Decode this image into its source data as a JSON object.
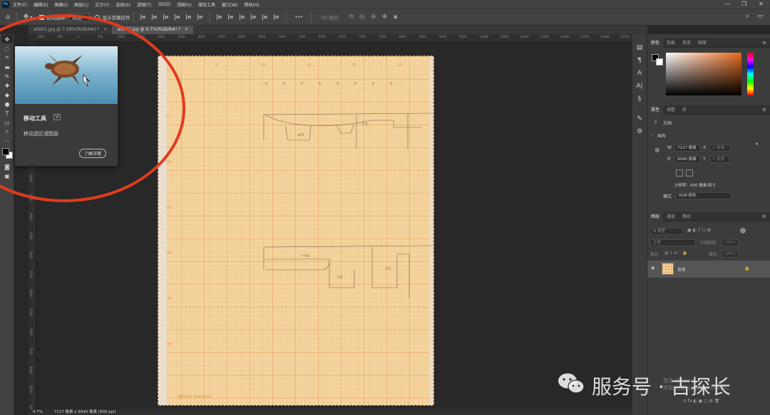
{
  "menubar": {
    "items": [
      "文件(F)",
      "编辑(E)",
      "图像(I)",
      "图层(L)",
      "文字(Y)",
      "选择(S)",
      "滤镜(T)",
      "3D(D)",
      "视图(V)",
      "增效工具",
      "窗口(W)",
      "帮助(H)"
    ],
    "app_icon": "Ps"
  },
  "optbar": {
    "auto_select_label": "自动选择:",
    "auto_select_value": "图层",
    "show_transform_label": "显示变换控件",
    "mode_3d_label": "3D 模式:",
    "more": "•••"
  },
  "tabs": [
    {
      "label": "a0001.jpg @ 7.58%(RGB/8#) *",
      "active": false
    },
    {
      "label": "a0002.jpg @ 9.7%(RGB/8#) *",
      "active": true
    }
  ],
  "ruler": {
    "h_ticks": [
      "1000",
      "500",
      "0",
      "500",
      "1000",
      "1500",
      "2000",
      "2500",
      "3000",
      "3500",
      "4000",
      "4500",
      "5000",
      "5500",
      "6000",
      "6500",
      "7000",
      "7500",
      "8000",
      "8500",
      "9000",
      "9500",
      "10000",
      "10500",
      "11000",
      "11500",
      "12000",
      "12500",
      "13000",
      "13500"
    ],
    "v_ticks": [
      "0",
      "500",
      "1000",
      "1500",
      "2000",
      "2500",
      "3000",
      "3500",
      "4000",
      "4500",
      "5000",
      "5500",
      "6000",
      "6500",
      "7000",
      "7500",
      "8000",
      "8500",
      "9000"
    ]
  },
  "tooltip": {
    "title": "移动工具",
    "shortcut": "V",
    "description": "移动选区或图层",
    "learn_more": "了解详情"
  },
  "paper": {
    "footer": "番号Y04    555X5公分",
    "top_numbers": [
      "5",
      "16",
      "10",
      "20",
      "15"
    ],
    "side_numbers": [
      "0",
      "5",
      "10",
      "15",
      "20",
      "25",
      "30"
    ],
    "sketch_labels_top": [
      "2",
      "3",
      "5",
      "5",
      "3",
      "5",
      "5",
      "5"
    ],
    "sketch_text_1": "a25",
    "sketch_text_2": "Ｆ4",
    "sketch_text_3": "Ｓ6",
    "sketch_text_4": "Ｆ4Ａ",
    "sketch_text_5": "Ａ5"
  },
  "panels": {
    "color_tabs": [
      "颜色",
      "色板",
      "渐变",
      "图案"
    ],
    "properties_tabs": [
      "属性",
      "调整",
      "库"
    ],
    "doc_label": "文档",
    "canvas_section": "画布",
    "w_label": "W",
    "w_value": "7127 像素",
    "h_label": "H",
    "h_value": "9040 像素",
    "x_label": "X",
    "x_value": "0 像素",
    "y_label": "Y",
    "y_value": "0 像素",
    "resolution": "分辨率：600 像素/英寸",
    "mode_label": "模式",
    "mode_value": "RGB 颜色",
    "layers_tabs": [
      "图层",
      "通道",
      "路径"
    ],
    "kind_filter": "Q 类型",
    "blend_mode": "正常",
    "opacity_label": "不透明度:",
    "opacity_value": "100%",
    "lock_label": "锁定:",
    "fill_label": "填充:",
    "fill_value": "100%",
    "layer_name": "背景",
    "footer_icons": "⊝ fx ◐ ▣ ▢ ⊞ 🗑"
  },
  "statusbar": {
    "zoom": "9.7%",
    "doc_info": "7127 像素 x 9040 像素 (600 ppi)"
  },
  "watermark": {
    "text": "服务号 · 古探长",
    "win_activate_1": "激活 Windows",
    "win_activate_2": "转到\"设置\"以激活 Windows。"
  },
  "colors": {
    "accent_red": "#e23b1f",
    "paper": "#f4d49d",
    "ui_dark": "#282828"
  }
}
